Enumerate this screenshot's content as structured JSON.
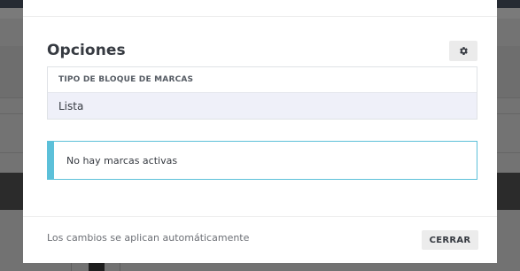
{
  "modal": {
    "title": "Opciones",
    "settings_icon": "gear-icon",
    "block_type": {
      "header": "TIPO DE BLOQUE DE MARCAS",
      "selected": "Lista"
    },
    "alert": {
      "message": "No hay marcas activas",
      "accent_color": "#5cc0d9"
    },
    "footer": {
      "note": "Los cambios se aplican automáticamente",
      "close_label": "CERRAR"
    }
  }
}
